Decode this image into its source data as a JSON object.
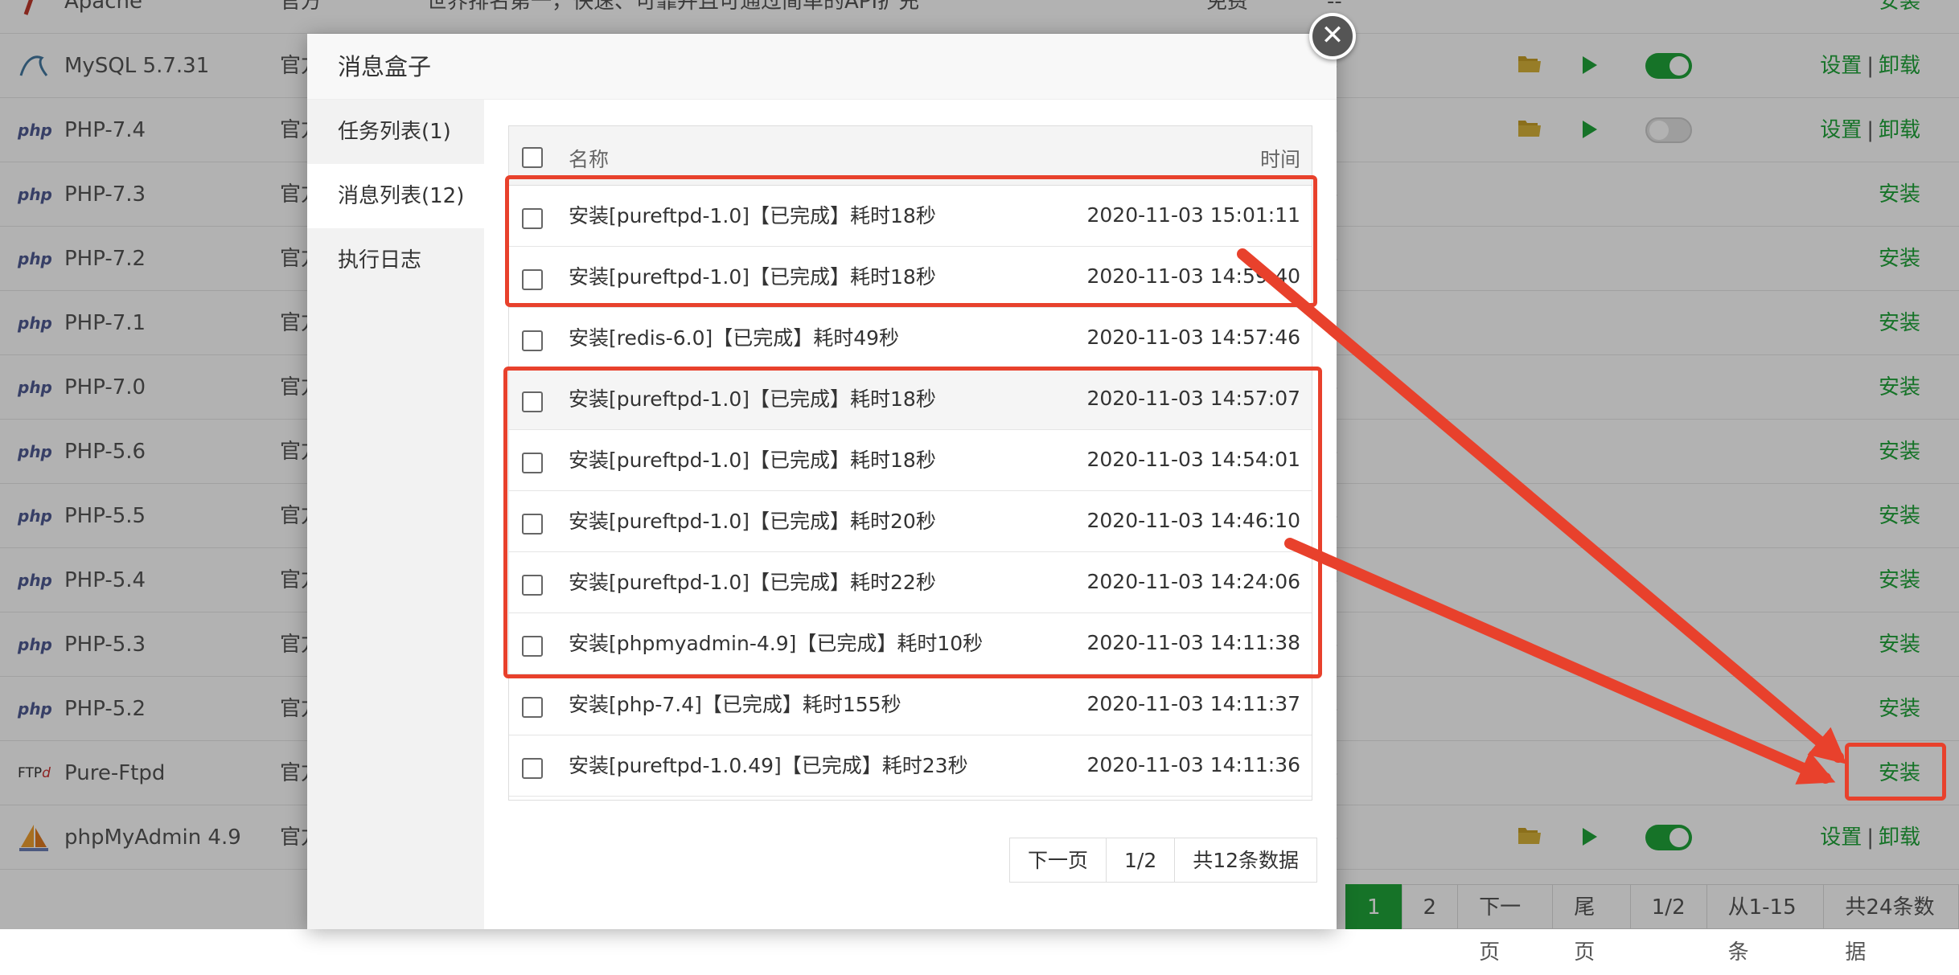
{
  "software_list": [
    {
      "name": "Apache",
      "icon": "apache-feather-icon",
      "type": "官方",
      "desc": "世界排名第一，快速、可靠并且可通过简单的API扩充",
      "price": "免费",
      "dash": "--",
      "action": "安装",
      "controls": false
    },
    {
      "name": "MySQL 5.7.31",
      "icon": "mysql-dolphin-icon",
      "type": "官方",
      "dash": "-",
      "action": "设置",
      "action2": "卸载",
      "controls": true,
      "toggle": "on"
    },
    {
      "name": "PHP-7.4",
      "icon": "php-logo-icon",
      "type": "官方",
      "dash": "-",
      "action": "设置",
      "action2": "卸载",
      "controls": true,
      "toggle": "off"
    },
    {
      "name": "PHP-7.3",
      "icon": "php-logo-icon",
      "type": "官方",
      "dash": "-",
      "action": "安装",
      "controls": false
    },
    {
      "name": "PHP-7.2",
      "icon": "php-logo-icon",
      "type": "官方",
      "dash": "-",
      "action": "安装",
      "controls": false
    },
    {
      "name": "PHP-7.1",
      "icon": "php-logo-icon",
      "type": "官方",
      "dash": "-",
      "action": "安装",
      "controls": false
    },
    {
      "name": "PHP-7.0",
      "icon": "php-logo-icon",
      "type": "官方",
      "dash": "-",
      "action": "安装",
      "controls": false
    },
    {
      "name": "PHP-5.6",
      "icon": "php-logo-icon",
      "type": "官方",
      "dash": "-",
      "action": "安装",
      "controls": false
    },
    {
      "name": "PHP-5.5",
      "icon": "php-logo-icon",
      "type": "官方",
      "dash": "-",
      "action": "安装",
      "controls": false
    },
    {
      "name": "PHP-5.4",
      "icon": "php-logo-icon",
      "type": "官方",
      "dash": "-",
      "action": "安装",
      "controls": false
    },
    {
      "name": "PHP-5.3",
      "icon": "php-logo-icon",
      "type": "官方",
      "dash": "-",
      "action": "安装",
      "controls": false
    },
    {
      "name": "PHP-5.2",
      "icon": "php-logo-icon",
      "type": "官方",
      "dash": "-",
      "action": "安装",
      "controls": false
    },
    {
      "name": "Pure-Ftpd",
      "icon": "ftpd-logo-icon",
      "type": "官方",
      "dash": "-",
      "action": "安装",
      "controls": false
    },
    {
      "name": "phpMyAdmin 4.9",
      "icon": "phpmyadmin-sail-icon",
      "type": "官方",
      "dash": "-",
      "action": "设置",
      "action2": "卸载",
      "controls": true,
      "toggle": "on"
    }
  ],
  "bg_pager": [
    "1",
    "2",
    "下一页",
    "尾页",
    "1/2",
    "从1-15条",
    "共24条数据"
  ],
  "modal": {
    "title": "消息盒子",
    "close_glyph": "✕",
    "sidebar": [
      "任务列表(1)",
      "消息列表(12)",
      "执行日志"
    ],
    "table_header": {
      "name": "名称",
      "time": "时间"
    },
    "rows": [
      {
        "name": "安装[pureftpd-1.0]【已完成】耗时18秒",
        "time": "2020-11-03 15:01:11"
      },
      {
        "name": "安装[pureftpd-1.0]【已完成】耗时18秒",
        "time": "2020-11-03 14:59:40"
      },
      {
        "name": "安装[redis-6.0]【已完成】耗时49秒",
        "time": "2020-11-03 14:57:46"
      },
      {
        "name": "安装[pureftpd-1.0]【已完成】耗时18秒",
        "time": "2020-11-03 14:57:07"
      },
      {
        "name": "安装[pureftpd-1.0]【已完成】耗时18秒",
        "time": "2020-11-03 14:54:01"
      },
      {
        "name": "安装[pureftpd-1.0]【已完成】耗时20秒",
        "time": "2020-11-03 14:46:10"
      },
      {
        "name": "安装[pureftpd-1.0]【已完成】耗时22秒",
        "time": "2020-11-03 14:24:06"
      },
      {
        "name": "安装[phpmyadmin-4.9]【已完成】耗时10秒",
        "time": "2020-11-03 14:11:38"
      },
      {
        "name": "安装[php-7.4]【已完成】耗时155秒",
        "time": "2020-11-03 14:11:37"
      },
      {
        "name": "安装[pureftpd-1.0.49]【已完成】耗时23秒",
        "time": "2020-11-03 14:11:36"
      }
    ],
    "pager": [
      "下一页",
      "1/2",
      "共12条数据"
    ]
  },
  "colors": {
    "accent": "#20a53a",
    "annotation": "#e8412c"
  }
}
